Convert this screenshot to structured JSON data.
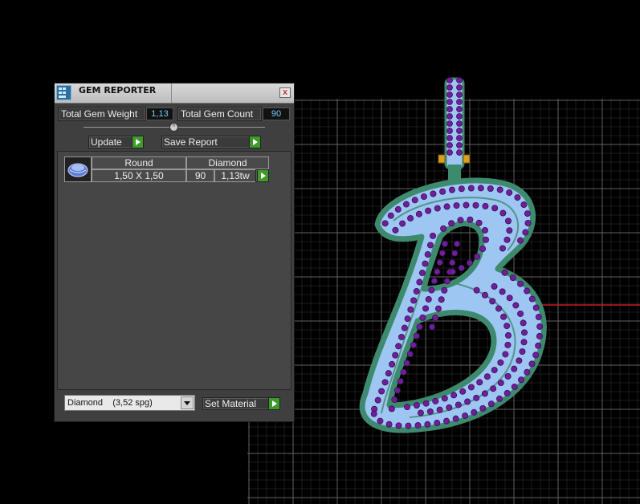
{
  "panel": {
    "title": "GEM REPORTER",
    "close_glyph": "x",
    "total_weight_label": "Total Gem Weight",
    "total_weight_value": "1,13",
    "total_count_label": "Total Gem Count",
    "total_count_value": "90",
    "update_label": "Update",
    "save_report_label": "Save Report",
    "gem_row": {
      "shape": "Round",
      "material": "Diamond",
      "size": "1,50 X 1,50",
      "count": "90",
      "weight": "1,13tw"
    },
    "material_select_value": "Diamond    (3,52 spg)",
    "set_material_label": "Set Material"
  },
  "icons": {
    "app": "gem-reporter-icon",
    "close": "close-icon",
    "play": "green-arrow-icon",
    "thumb": "round-gem-icon"
  },
  "colors": {
    "grid_line": "#6a6a6a",
    "axis_red": "#c21e1e",
    "letter_fill": "#9ec6f2",
    "letter_outline": "#3e8a6e",
    "gem_purple": "#6e1f9a",
    "value_text": "#6fd0ff",
    "play_green": "#3e9b2a"
  }
}
